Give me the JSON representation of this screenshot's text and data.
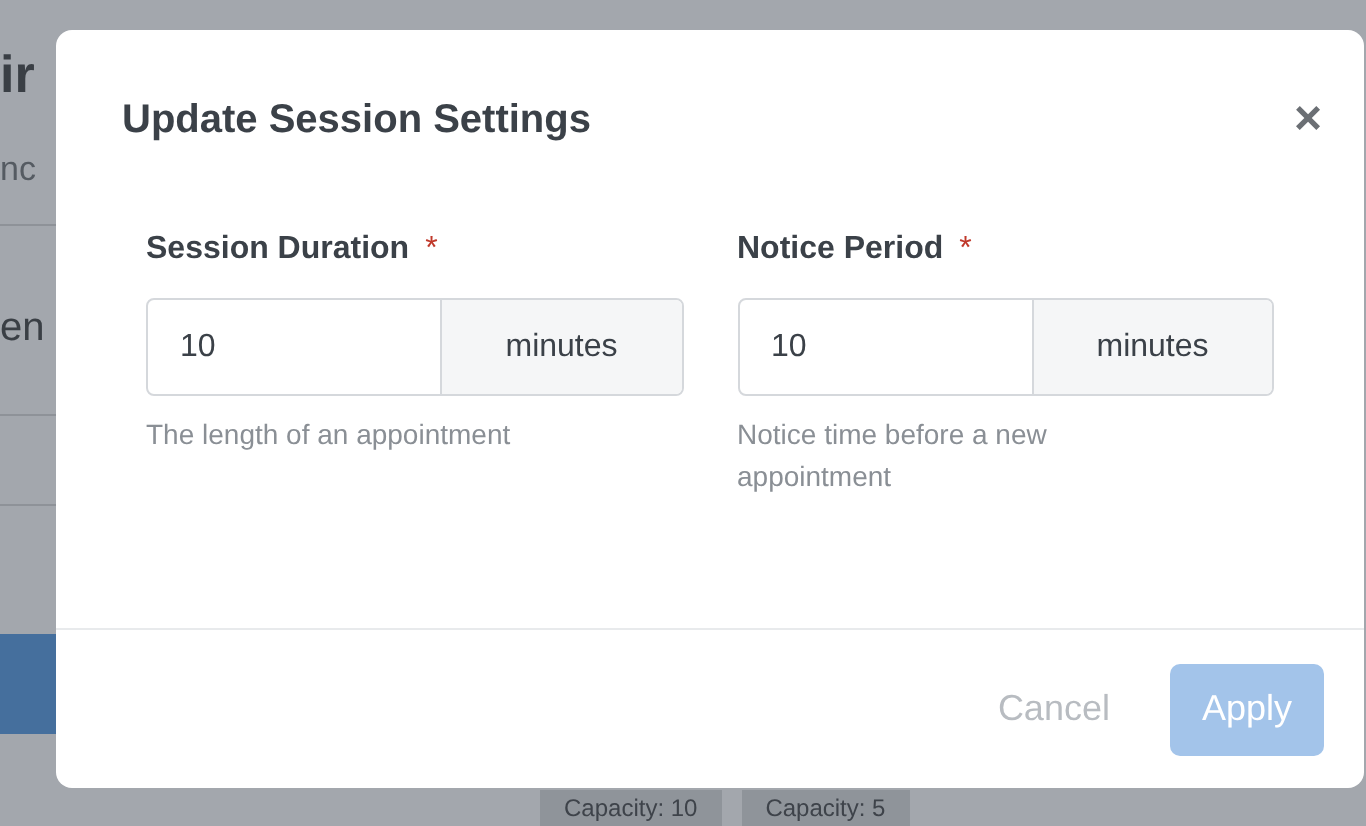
{
  "background": {
    "heading_fragment": "ir",
    "text_fragment": "nc",
    "subheading_fragment": "en",
    "tags": [
      "Capacity: 10",
      "Capacity: 5"
    ]
  },
  "dialog": {
    "title": "Update Session Settings",
    "close": "×",
    "fields": [
      {
        "label": "Session Duration",
        "required": "*",
        "value": "10",
        "unit": "minutes",
        "hint": "The length of an appointment"
      },
      {
        "label": "Notice Period",
        "required": "*",
        "value": "10",
        "unit": "minutes",
        "hint": "Notice time before a new appointment"
      }
    ],
    "buttons": [
      {
        "label": "Cancel",
        "kind": "secondary",
        "disabled": false
      },
      {
        "label": "Apply",
        "kind": "primary",
        "disabled": true
      }
    ]
  }
}
